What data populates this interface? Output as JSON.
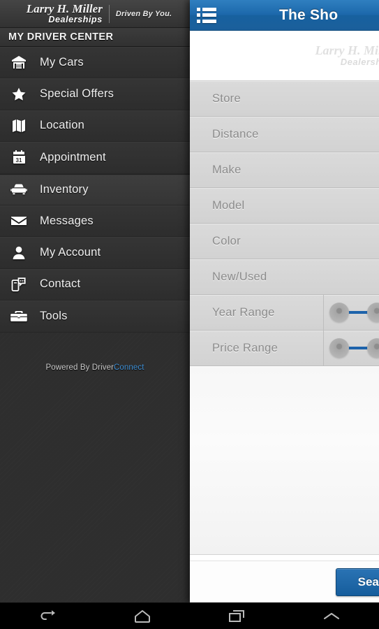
{
  "sidebar": {
    "logo": {
      "script": "Larry H. Miller",
      "sub": "Dealerships",
      "tagline": "Driven By You."
    },
    "drawer_title": "MY DRIVER CENTER",
    "items": [
      {
        "label": "My Cars",
        "icon": "garage-icon",
        "active": false
      },
      {
        "label": "Special Offers",
        "icon": "star-icon",
        "active": false
      },
      {
        "label": "Location",
        "icon": "map-icon",
        "active": false
      },
      {
        "label": "Appointment",
        "icon": "calendar-icon",
        "active": false
      },
      {
        "label": "Inventory",
        "icon": "car-icon",
        "active": true
      },
      {
        "label": "Messages",
        "icon": "envelope-icon",
        "active": false
      },
      {
        "label": "My Account",
        "icon": "person-icon",
        "active": false
      },
      {
        "label": "Contact",
        "icon": "phone-chat-icon",
        "active": false
      },
      {
        "label": "Tools",
        "icon": "toolbox-icon",
        "active": false
      }
    ],
    "footer": {
      "prefix": "Powered By Driver",
      "brand": "Connect",
      "brand_color": "#3f8fd4"
    }
  },
  "panel": {
    "header": {
      "title": "The Sho",
      "menu_icon": "list-icon",
      "accent_color": "#1c68ab"
    },
    "watermark": {
      "script": "Larry H. Miller",
      "sub": "Dealerships"
    },
    "filters": [
      {
        "label": "Store",
        "type": "select"
      },
      {
        "label": "Distance",
        "type": "select"
      },
      {
        "label": "Make",
        "type": "select"
      },
      {
        "label": "Model",
        "type": "select"
      },
      {
        "label": "Color",
        "type": "select"
      },
      {
        "label": "New/Used",
        "type": "select"
      },
      {
        "label": "Year Range",
        "type": "range-slider"
      },
      {
        "label": "Price Range",
        "type": "range-slider"
      }
    ],
    "action": {
      "search_label": "Search"
    }
  },
  "navbar": {
    "buttons": [
      {
        "name": "back-icon"
      },
      {
        "name": "home-icon"
      },
      {
        "name": "recents-icon"
      },
      {
        "name": "chevron-up-icon"
      }
    ]
  }
}
